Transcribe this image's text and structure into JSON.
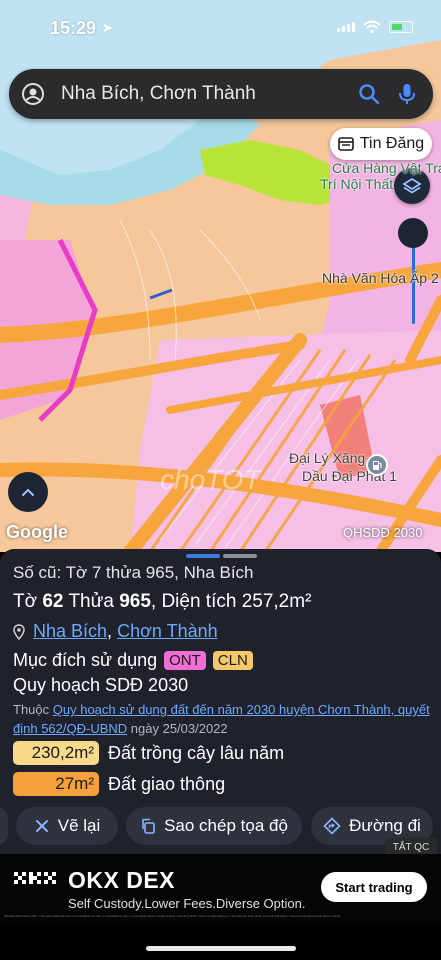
{
  "status": {
    "time": "15:29"
  },
  "search": {
    "query": "Nha Bích, Chơn Thành"
  },
  "map": {
    "tin_dang_label": "Tin Đăng",
    "labels": {
      "shop_line1": "Cửa Hàng Vật Tra",
      "shop_line2": "Trí Nội Thất",
      "cultural_house": "Nhà Văn Hóa Ấp 2",
      "fuel_line1": "Đại Lý Xăng",
      "fuel_line2": "Dầu Đại Phát 1"
    },
    "google": "Google",
    "plan_tag": "QHSDĐ 2030",
    "watermark": "choTOT"
  },
  "sheet": {
    "old_id": "Số cũ: Tờ 7 thửa 965, Nha Bích",
    "main": {
      "to_label": "Tờ",
      "to_value": "62",
      "thua_label": "Thửa",
      "thua_value": "965",
      "area_text": ", Diện tích 257,2m²"
    },
    "address": {
      "commune": "Nha Bích",
      "sep": ",",
      "district": "Chơn Thành"
    },
    "purpose_label": "Mục đích sử dụng",
    "purpose_badges": [
      "ONT",
      "CLN"
    ],
    "plan_label": "Quy hoạch SDĐ 2030",
    "ref": {
      "prefix": "Thuộc",
      "link": "Quy hoạch sử dụng đất đến năm 2030 huyện Chơn Thành, quyết định 562/QĐ-UBND",
      "date": "ngày 25/03/2022"
    },
    "areas": [
      {
        "value": "230,2m²",
        "label": "Đất trồng cây lâu năm"
      },
      {
        "value": "27m²",
        "label": "Đất giao thông"
      }
    ],
    "actions": {
      "redraw": "Vẽ lại",
      "copy": "Sao chép tọa độ",
      "route": "Đường đi"
    }
  },
  "ad": {
    "close_label": "TẮT QC",
    "brand": "OKX DEX",
    "tagline": "Self Custody.Lower Fees.Diverse Option.",
    "cta": "Start trading",
    "fine_print": "Sidebar Alfred Entry Man. This advertisement does not constitute an offer or solicitation to buy or sell digital assets. Digital assets, including NFTs, involve a high degree of risk and can lose value. Consult with legal / investment professionals before acting."
  },
  "colors": {
    "ont": "#f06dd6",
    "cln": "#f5c86a",
    "chip_lau_nam": "#f9d98b",
    "chip_giao_thong": "#f6a03b",
    "grab_active": "#3d7be0",
    "grab_idle": "#8b8f99"
  }
}
